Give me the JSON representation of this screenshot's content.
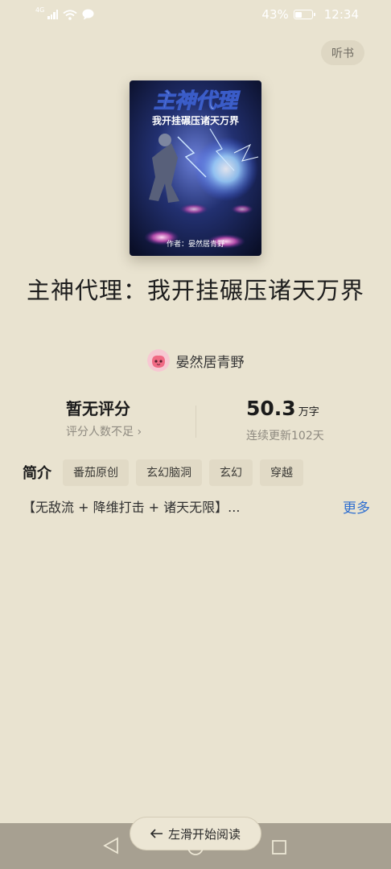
{
  "status_bar": {
    "network": "4G",
    "battery": "43%",
    "battery_level": 0.43,
    "time": "12:34"
  },
  "header": {
    "listen_label": "听书"
  },
  "book": {
    "cover": {
      "title": "主神代理",
      "subtitle": "我开挂碾压诸天万界",
      "author_line": "作者：晏然居青野"
    },
    "title": "主神代理：我开挂碾压诸天万界",
    "author": "晏然居青野"
  },
  "stats": {
    "rating": "暂无评分",
    "rating_sub": "评分人数不足 ›",
    "word_count": "50.3",
    "word_unit": "万字",
    "update_sub": "连续更新102天"
  },
  "intro": {
    "label": "简介",
    "tags": [
      "番茄原创",
      "玄幻脑洞",
      "玄幻",
      "穿越"
    ],
    "text": "【无敌流 + 降维打击 + 诸天无限】...",
    "more": "更多"
  },
  "bottom": {
    "swipe_label": "左滑开始阅读"
  }
}
